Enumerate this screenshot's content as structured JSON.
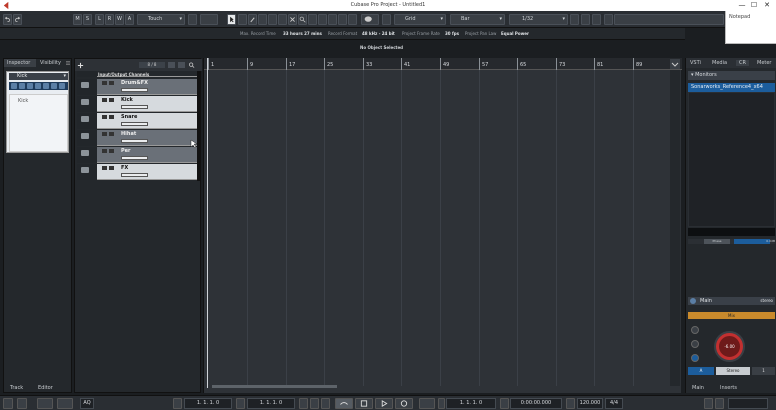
{
  "window": {
    "title": "Cubase Pro Project - Untitled1",
    "minimize": "—",
    "maximize": "☐",
    "close": "✕"
  },
  "notepad": {
    "title": "Notepad"
  },
  "toolbar": {
    "letters": [
      "M",
      "S",
      "L",
      "R",
      "W",
      "A"
    ],
    "automation_mode": "Touch",
    "snap_type": "Grid",
    "grid_type": "Bar",
    "quantize": "1/32"
  },
  "infoline": {
    "max_record_label": "Max. Record Time",
    "max_record_value": "33 hours 27 mins",
    "format_label": "Record Format",
    "format_value": "48 kHz - 24 bit",
    "fps_label": "Project Frame Rate",
    "fps_value": "30 fps",
    "panlaw_label": "Project Pan Law",
    "panlaw_value": "Equal Power"
  },
  "selection": {
    "text": "No Object Selected"
  },
  "inspector": {
    "tab_inspector": "Inspector",
    "tab_visibility": "Visibility",
    "track_name": "Kick",
    "sub_label": "Kick",
    "tab_track": "Track",
    "tab_editor": "Editor"
  },
  "tracklist": {
    "count": "8 / 8",
    "tracks": [
      {
        "name": "Input/Output Channels",
        "kind": "header"
      },
      {
        "name": "Drum&FX",
        "kind": "group"
      },
      {
        "name": "Kick",
        "kind": "track"
      },
      {
        "name": "Snare",
        "kind": "track"
      },
      {
        "name": "Hihat",
        "kind": "group"
      },
      {
        "name": "Per",
        "kind": "group"
      },
      {
        "name": "FX",
        "kind": "track"
      }
    ]
  },
  "ruler": {
    "bars": [
      "1",
      "9",
      "17",
      "25",
      "33",
      "41",
      "49",
      "57",
      "65",
      "73",
      "81",
      "89"
    ]
  },
  "rightpanel": {
    "tabs": [
      "VSTi",
      "Media",
      "CR",
      "Meter"
    ],
    "monitors_label": "Monitors",
    "monitor_item": "Sonarworks_Reference4_x64",
    "phase_label": "Phase",
    "phase_value": "0.0dB",
    "main_label": "Main",
    "main_format": "stereo",
    "mix_label": "Mix",
    "knob_value": "-6.00",
    "out_a": "A",
    "out_stereo": "Stereo",
    "out_1": "1",
    "tab_main": "Main",
    "tab_inserts": "Inserts"
  },
  "transport": {
    "left_locator": "1. 1. 1.  0",
    "right_locator": "1. 1. 1.  0",
    "position": "1. 1. 1.  0",
    "time": "0:00:00.000",
    "tempo": "120.000",
    "signature": "4/4",
    "aq": "AQ"
  }
}
